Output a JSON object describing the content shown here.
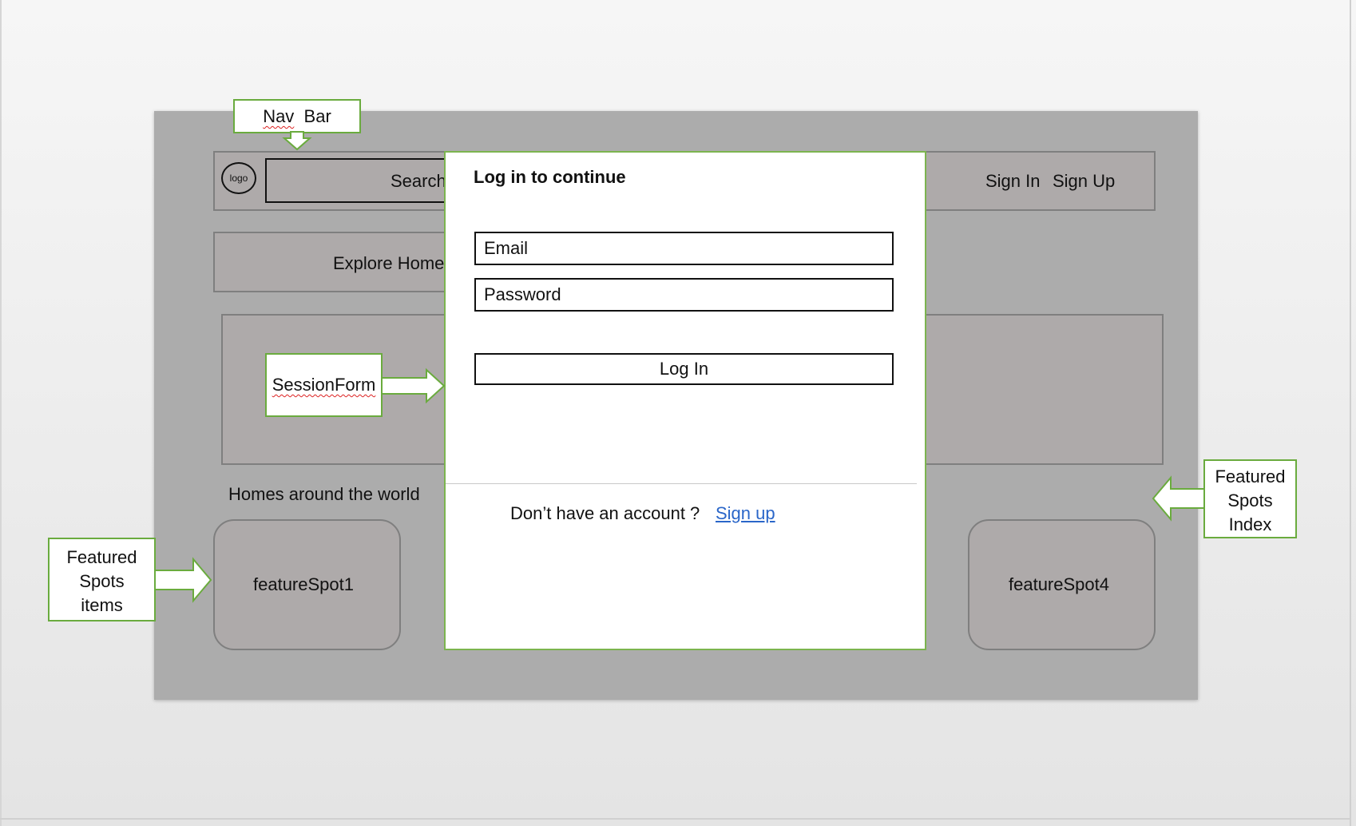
{
  "navbar": {
    "logo_label": "logo",
    "search_label": "Search",
    "sign_in": "Sign In",
    "sign_up": "Sign Up"
  },
  "explore": {
    "label": "Explore Home"
  },
  "section": {
    "heading": "Homes around the world"
  },
  "featured_spots": [
    {
      "label": "featureSpot1"
    },
    {
      "label": "featureSpot4"
    }
  ],
  "modal": {
    "title": "Log in to continue",
    "email_placeholder": "Email",
    "password_placeholder": "Password",
    "login_button": "Log In",
    "footer_text": "Don’t have an account ?",
    "signup_link": "Sign up"
  },
  "callouts": {
    "nav_bar": {
      "word1": "Nav",
      "word2": "Bar"
    },
    "session_form": "SessionForm",
    "featured_items": [
      "Featured",
      "Spots",
      "items"
    ],
    "featured_index": [
      "Featured",
      "Spots",
      "Index"
    ]
  },
  "colors": {
    "callout_border": "#6aab3e",
    "slide_background": "#acacac",
    "link": "#2a66c9"
  }
}
